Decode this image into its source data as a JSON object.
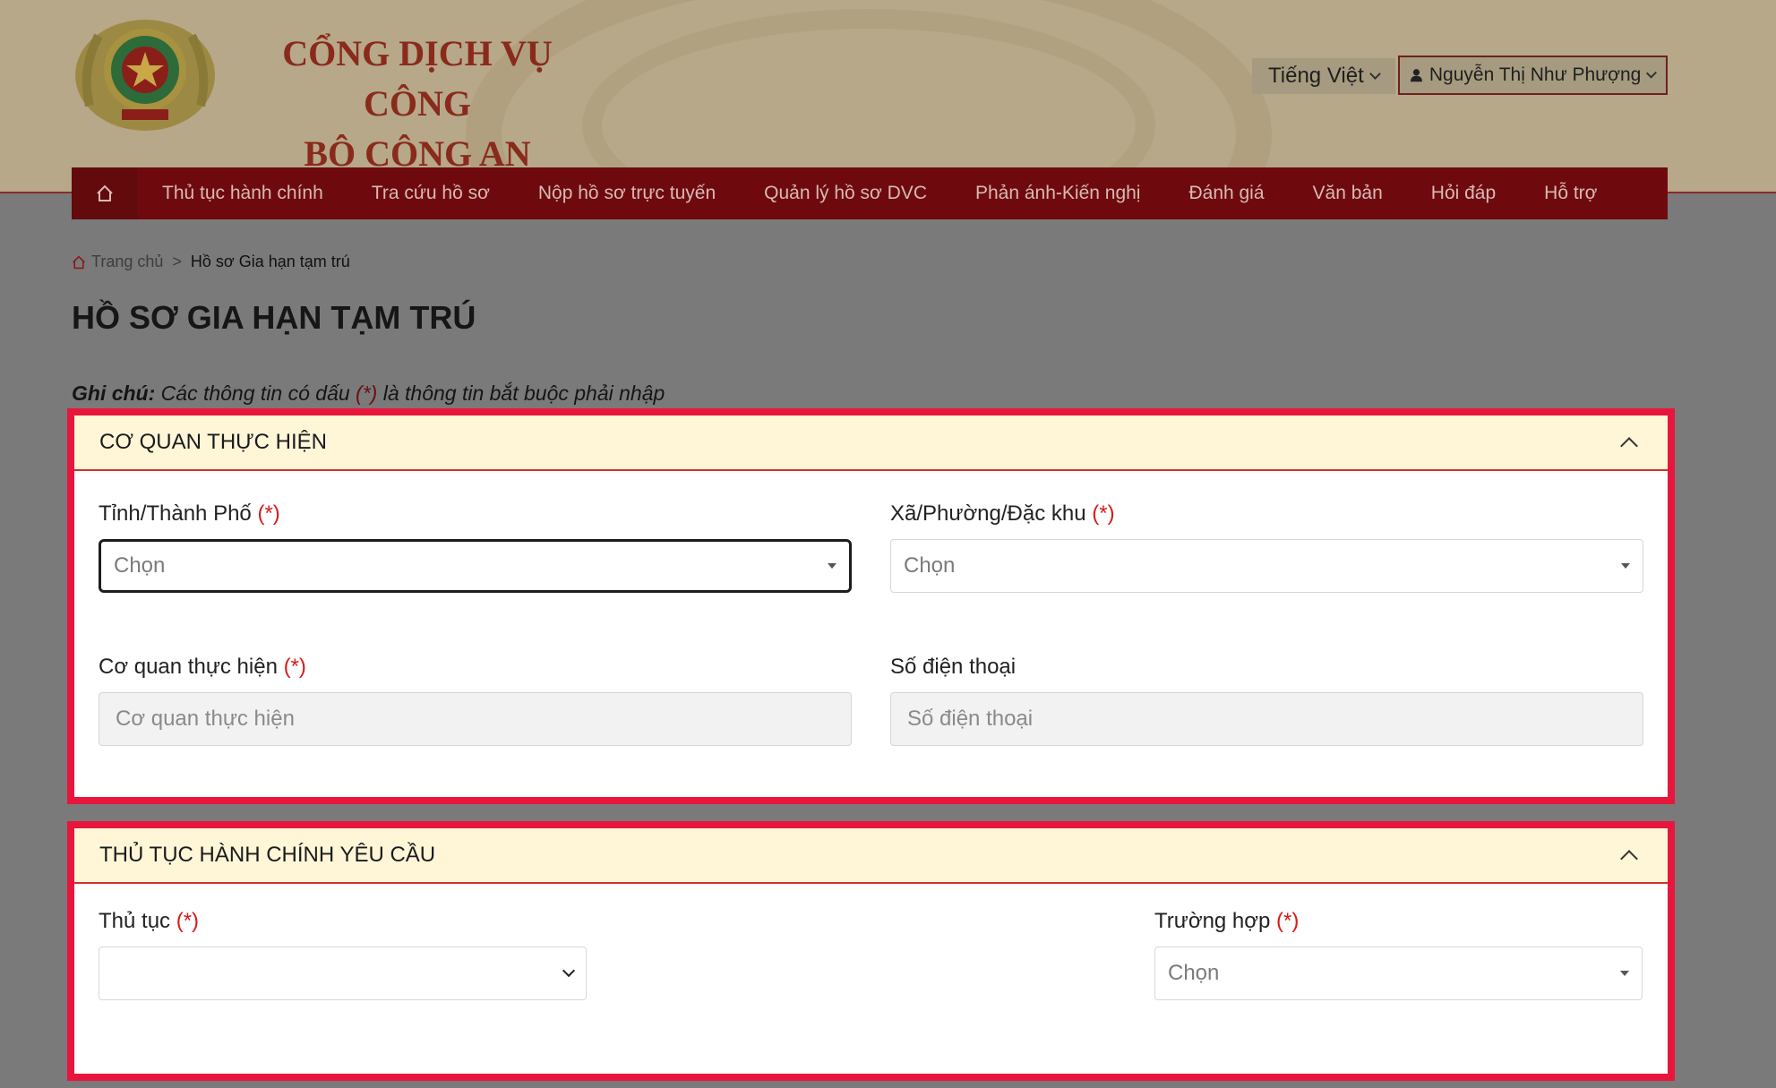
{
  "header": {
    "title_line1": "CỔNG DỊCH VỤ CÔNG",
    "title_line2": "BỘ CÔNG AN",
    "language": "Tiếng Việt",
    "user_name": "Nguyễn Thị Như Phượng"
  },
  "nav": {
    "items": [
      "Thủ tục hành chính",
      "Tra cứu hồ sơ",
      "Nộp hồ sơ trực tuyến",
      "Quản lý hồ sơ DVC",
      "Phản ánh-Kiến nghị",
      "Đánh giá",
      "Văn bản",
      "Hỏi đáp",
      "Hỗ trợ"
    ]
  },
  "breadcrumb": {
    "home": "Trang chủ",
    "separator": ">",
    "current": "Hồ sơ Gia hạn tạm trú"
  },
  "page": {
    "title": "HỒ SƠ GIA HẠN TẠM TRÚ",
    "note_label": "Ghi chú:",
    "note_text_1": " Các thông tin có dấu ",
    "note_required": "(*)",
    "note_text_2": " là thông tin bắt buộc phải nhập"
  },
  "section_agency": {
    "title": "CƠ QUAN THỰC HIỆN",
    "province_label": "Tỉnh/Thành Phố",
    "province_placeholder": "Chọn",
    "ward_label": "Xã/Phường/Đặc khu",
    "ward_placeholder": "Chọn",
    "agency_label": "Cơ quan thực hiện",
    "agency_placeholder": "Cơ quan thực hiện",
    "phone_label": "Số điện thoại",
    "phone_placeholder": "Số điện thoại",
    "required_mark": "(*)"
  },
  "section_procedure": {
    "title": "THỦ TỤC HÀNH CHÍNH YÊU CẦU",
    "procedure_label": "Thủ tục",
    "procedure_value": "",
    "case_label": "Trường hợp",
    "case_placeholder": "Chọn",
    "required_mark": "(*)"
  },
  "colors": {
    "nav_bg": "#6e0a0e",
    "highlight_border": "#e8163d",
    "panel_header_bg": "#fff6d8",
    "required": "#d81b1b"
  }
}
